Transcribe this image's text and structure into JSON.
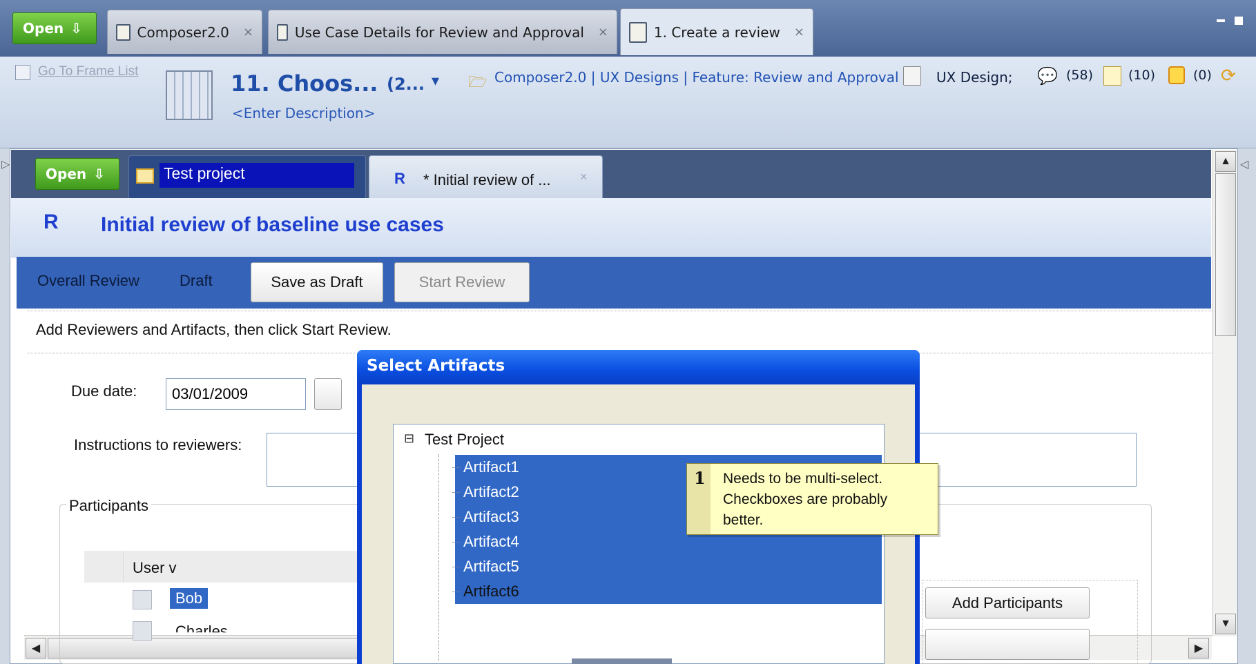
{
  "outer_tabs": {
    "open_label": "Open",
    "tabs": [
      {
        "label": "Composer2.0"
      },
      {
        "label": "Use Case Details for Review and Approval"
      },
      {
        "label": "1. Create a review"
      }
    ],
    "close_glyph": "×"
  },
  "frame_header": {
    "go_to_frame_list": "Go To Frame List",
    "frame_title": "11. Choos...",
    "frame_count": "(2...",
    "description_placeholder": "<Enter Description>",
    "breadcrumb": "Composer2.0 | UX Designs | Feature: Review and Approval",
    "category": "UX Design;",
    "comments_count": "(58)",
    "notes_count": "(10)",
    "flags_count": "(0)"
  },
  "inner_tabs": {
    "open_label": "Open",
    "project_tab": "Test project",
    "review_tab_letter": "R",
    "review_tab_label": "* Initial review of ...",
    "close_glyph": "×"
  },
  "review": {
    "letter": "R",
    "title": "Initial review of baseline use cases"
  },
  "toolbar": {
    "overall_review_label": "Overall Review",
    "status": "Draft",
    "save_draft_label": "Save as Draft",
    "start_review_label": "Start Review"
  },
  "instructions_hint": "Add Reviewers and Artifacts, then click Start Review.",
  "form": {
    "due_date_label": "Due date:",
    "due_date_value": "03/01/2009",
    "instructions_label": "Instructions to reviewers:",
    "participants_label": "Participants",
    "user_column_header": "User v",
    "participants": [
      "Bob",
      "Charles"
    ],
    "add_participants_label": "Add Participants"
  },
  "dialog": {
    "title": "Select Artifacts",
    "tree_root": "Test Project",
    "tree_expander": "⊟",
    "artifacts": [
      {
        "label": "Artifact1",
        "selected": true
      },
      {
        "label": "Artifact2",
        "selected": true
      },
      {
        "label": "Artifact3",
        "selected": true
      },
      {
        "label": "Artifact4",
        "selected": true
      },
      {
        "label": "Artifact5",
        "selected": true
      },
      {
        "label": "Artifact6",
        "selected": false
      }
    ]
  },
  "annotation": {
    "number": "1",
    "text_line1": "Needs to be multi-select.",
    "text_line2": "Checkboxes are probably",
    "text_line3": "better."
  },
  "colors": {
    "toolbar_blue": "#3563b8",
    "selection_blue": "#3168c6",
    "title_blue": "#1f3fcf",
    "dialog_blue": "#0a4ee0",
    "note_yellow": "#ffffc4"
  }
}
